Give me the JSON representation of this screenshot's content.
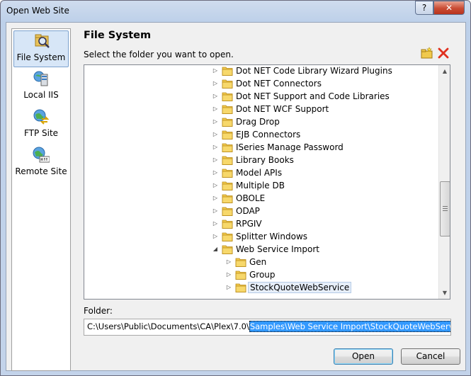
{
  "window": {
    "title": "Open Web Site",
    "help_label": "?",
    "close_label": "✕"
  },
  "sidebar": {
    "items": [
      {
        "label": "File System",
        "icon": "file-system-icon",
        "selected": true
      },
      {
        "label": "Local IIS",
        "icon": "local-iis-icon",
        "selected": false
      },
      {
        "label": "FTP Site",
        "icon": "ftp-site-icon",
        "selected": false
      },
      {
        "label": "Remote Site",
        "icon": "remote-site-icon",
        "selected": false
      }
    ]
  },
  "main": {
    "heading": "File System",
    "prompt": "Select the folder you want to open.",
    "new_folder_icon": "new-folder-icon",
    "delete_icon": "delete-icon"
  },
  "tree": {
    "rows": [
      {
        "label": "Dot NET Code Library Wizard Plugins",
        "level": 0,
        "expanded": false,
        "selected": false
      },
      {
        "label": "Dot NET Connectors",
        "level": 0,
        "expanded": false,
        "selected": false
      },
      {
        "label": "Dot NET Support and Code Libraries",
        "level": 0,
        "expanded": false,
        "selected": false
      },
      {
        "label": "Dot NET WCF Support",
        "level": 0,
        "expanded": false,
        "selected": false
      },
      {
        "label": "Drag Drop",
        "level": 0,
        "expanded": false,
        "selected": false
      },
      {
        "label": "EJB Connectors",
        "level": 0,
        "expanded": false,
        "selected": false
      },
      {
        "label": "ISeries Manage Password",
        "level": 0,
        "expanded": false,
        "selected": false
      },
      {
        "label": "Library Books",
        "level": 0,
        "expanded": false,
        "selected": false
      },
      {
        "label": "Model APIs",
        "level": 0,
        "expanded": false,
        "selected": false
      },
      {
        "label": "Multiple DB",
        "level": 0,
        "expanded": false,
        "selected": false
      },
      {
        "label": "OBOLE",
        "level": 0,
        "expanded": false,
        "selected": false
      },
      {
        "label": "ODAP",
        "level": 0,
        "expanded": false,
        "selected": false
      },
      {
        "label": "RPGIV",
        "level": 0,
        "expanded": false,
        "selected": false
      },
      {
        "label": "Splitter Windows",
        "level": 0,
        "expanded": false,
        "selected": false
      },
      {
        "label": "Web Service Import",
        "level": 0,
        "expanded": true,
        "selected": false
      },
      {
        "label": "Gen",
        "level": 1,
        "expanded": false,
        "selected": false
      },
      {
        "label": "Group",
        "level": 1,
        "expanded": false,
        "selected": false
      },
      {
        "label": "StockQuoteWebService",
        "level": 1,
        "expanded": false,
        "selected": true
      }
    ]
  },
  "folder": {
    "label": "Folder:",
    "path_prefix": "C:\\Users\\Public\\Documents\\CA\\Plex\\7.0\\",
    "path_selected": "Samples\\Web Service Import\\StockQuoteWebService"
  },
  "buttons": {
    "open": "Open",
    "cancel": "Cancel"
  }
}
